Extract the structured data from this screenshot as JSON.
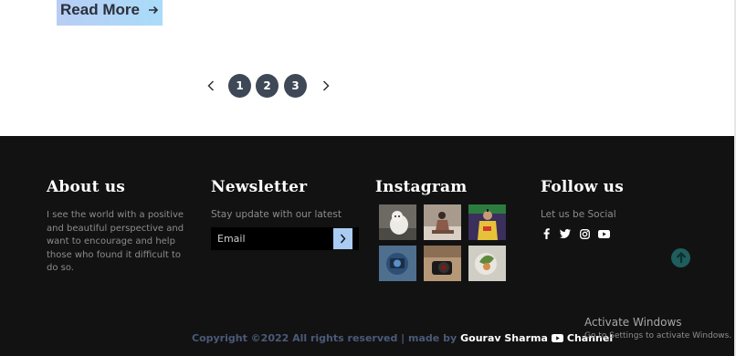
{
  "read_more": {
    "label": "Read More"
  },
  "pagination": {
    "pages": [
      "1",
      "2",
      "3"
    ]
  },
  "footer": {
    "about": {
      "title": "About us",
      "text": "I see the world with a positive and beautiful perspective and want to encourage and help those who found it difficult to do so."
    },
    "newsletter": {
      "title": "Newsletter",
      "text": "Stay update with our latest",
      "placeholder": "Email"
    },
    "instagram": {
      "title": "Instagram"
    },
    "follow": {
      "title": "Follow us",
      "text": "Let us be Social",
      "icons": [
        "facebook-icon",
        "twitter-icon",
        "instagram-icon",
        "youtube-icon"
      ]
    },
    "copyright": {
      "prefix": "Copyright ©2022 All rights reserved | made by",
      "author": "Gourav Sharma",
      "channel": "Channel"
    }
  },
  "activate_windows": {
    "title": "Activate Windows",
    "subtitle": "Go to Settings to activate Windows."
  },
  "colors": {
    "footer_bg": "#121212",
    "page_btn": "#3e4857",
    "accent_blue": "#a9ccf2",
    "back_to_top": "#1f5d5e"
  }
}
